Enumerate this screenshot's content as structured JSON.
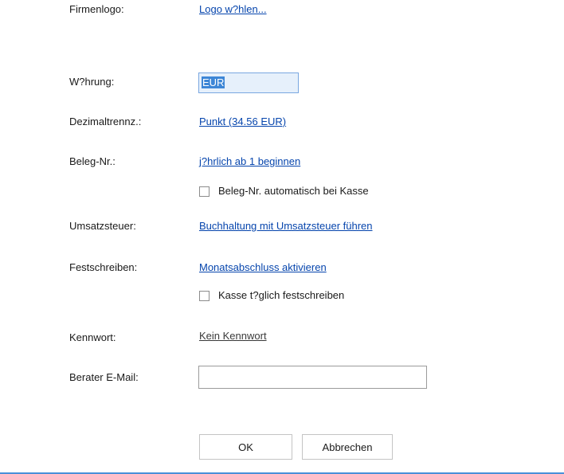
{
  "form": {
    "logo": {
      "label": "Firmenlogo:",
      "link": "Logo w?hlen..."
    },
    "currency": {
      "label": "W?hrung:",
      "value": "EUR"
    },
    "decimal": {
      "label": "Dezimaltrennz.:",
      "link": "Punkt (34.56 EUR)"
    },
    "receipt": {
      "label": "Beleg-Nr.:",
      "link": "j?hrlich ab 1 beginnen",
      "checkbox_label": "Beleg-Nr. automatisch bei Kasse",
      "checkbox_checked": false
    },
    "vat": {
      "label": "Umsatzsteuer:",
      "link": "Buchhaltung mit Umsatzsteuer führen"
    },
    "lock": {
      "label": "Festschreiben:",
      "link": "Monatsabschluss aktivieren",
      "checkbox_label": "Kasse t?glich festschreiben",
      "checkbox_checked": false
    },
    "password": {
      "label": "Kennwort:",
      "link": "Kein Kennwort"
    },
    "advisor_email": {
      "label": "Berater E-Mail:",
      "value": "",
      "placeholder": ""
    }
  },
  "buttons": {
    "ok": "OK",
    "cancel": "Abbrechen"
  },
  "colors": {
    "link": "#0645ad",
    "accent": "#4a90d9",
    "selection": "#3d86d6"
  }
}
